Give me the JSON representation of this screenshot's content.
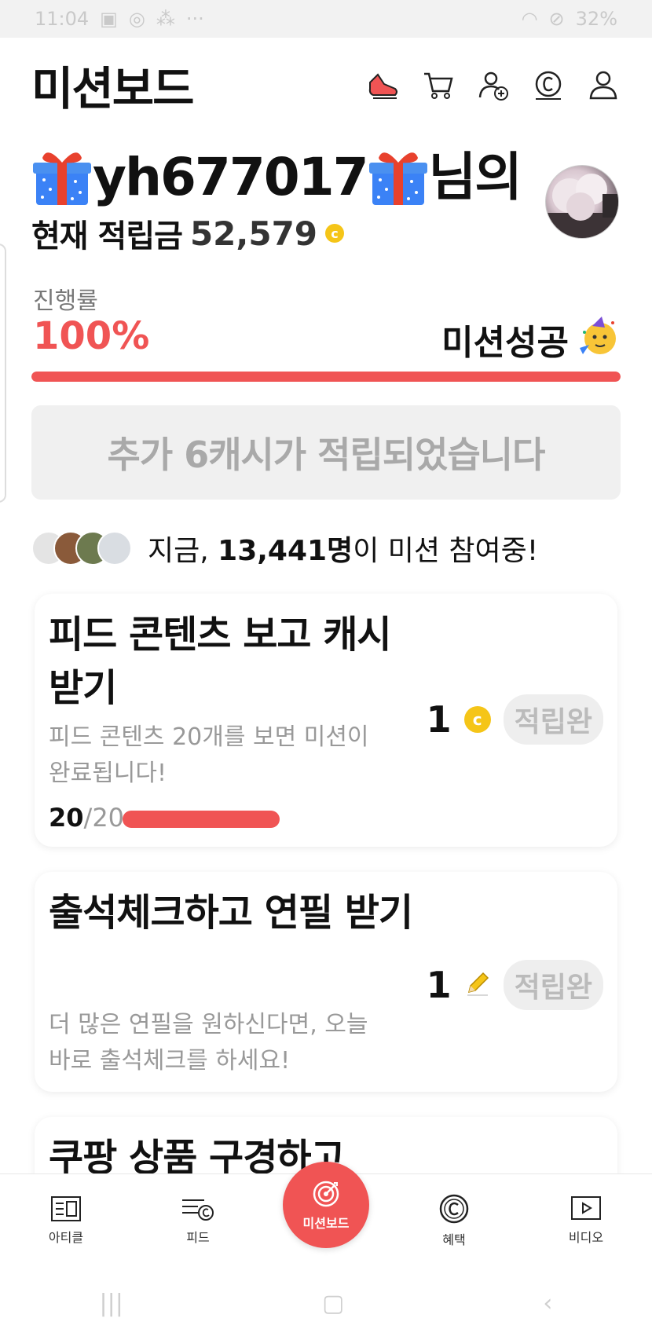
{
  "status": {
    "time": "11:04",
    "battery": "32%"
  },
  "header": {
    "title": "미션보드",
    "icons": [
      "shoe-icon",
      "cart-icon",
      "add-friend-icon",
      "cash-icon",
      "profile-icon"
    ]
  },
  "user": {
    "name": "yh677017",
    "suffix": "님의",
    "points_label": "현재 적립금",
    "points_value": "52,579"
  },
  "progress": {
    "label": "진행률",
    "value_text": "100%",
    "value": 1.0,
    "success_label": "미션성공"
  },
  "banner": {
    "text": "추가 6캐시가 적립되었습니다"
  },
  "participants": {
    "prefix": "지금,",
    "count": "13,441명",
    "suffix": "이 미션 참여중!"
  },
  "missions": [
    {
      "title": "피드 콘텐츠 보고 캐시 받기",
      "description": "피드 콘텐츠 20개를 보면 미션이 완료됩니다!",
      "reward": "1",
      "reward_icon": "coin-icon",
      "status": "적립완",
      "progress_current": "20",
      "progress_total": "/20",
      "progress_value": 1.0
    },
    {
      "title": "출석체크하고 연필 받기",
      "description": "더 많은 연필을 원하신다면, 오늘 바로 출석체크를 하세요!",
      "reward": "1",
      "reward_icon": "pencil-icon",
      "status": "적립완"
    },
    {
      "title": "쿠팡 상품 구경하고"
    }
  ],
  "bottom_nav": {
    "items": [
      "아티클",
      "피드",
      "미션보드",
      "혜택",
      "비디오"
    ],
    "active": "미션보드"
  },
  "colors": {
    "accent": "#f05454",
    "coin": "#f5c518"
  }
}
